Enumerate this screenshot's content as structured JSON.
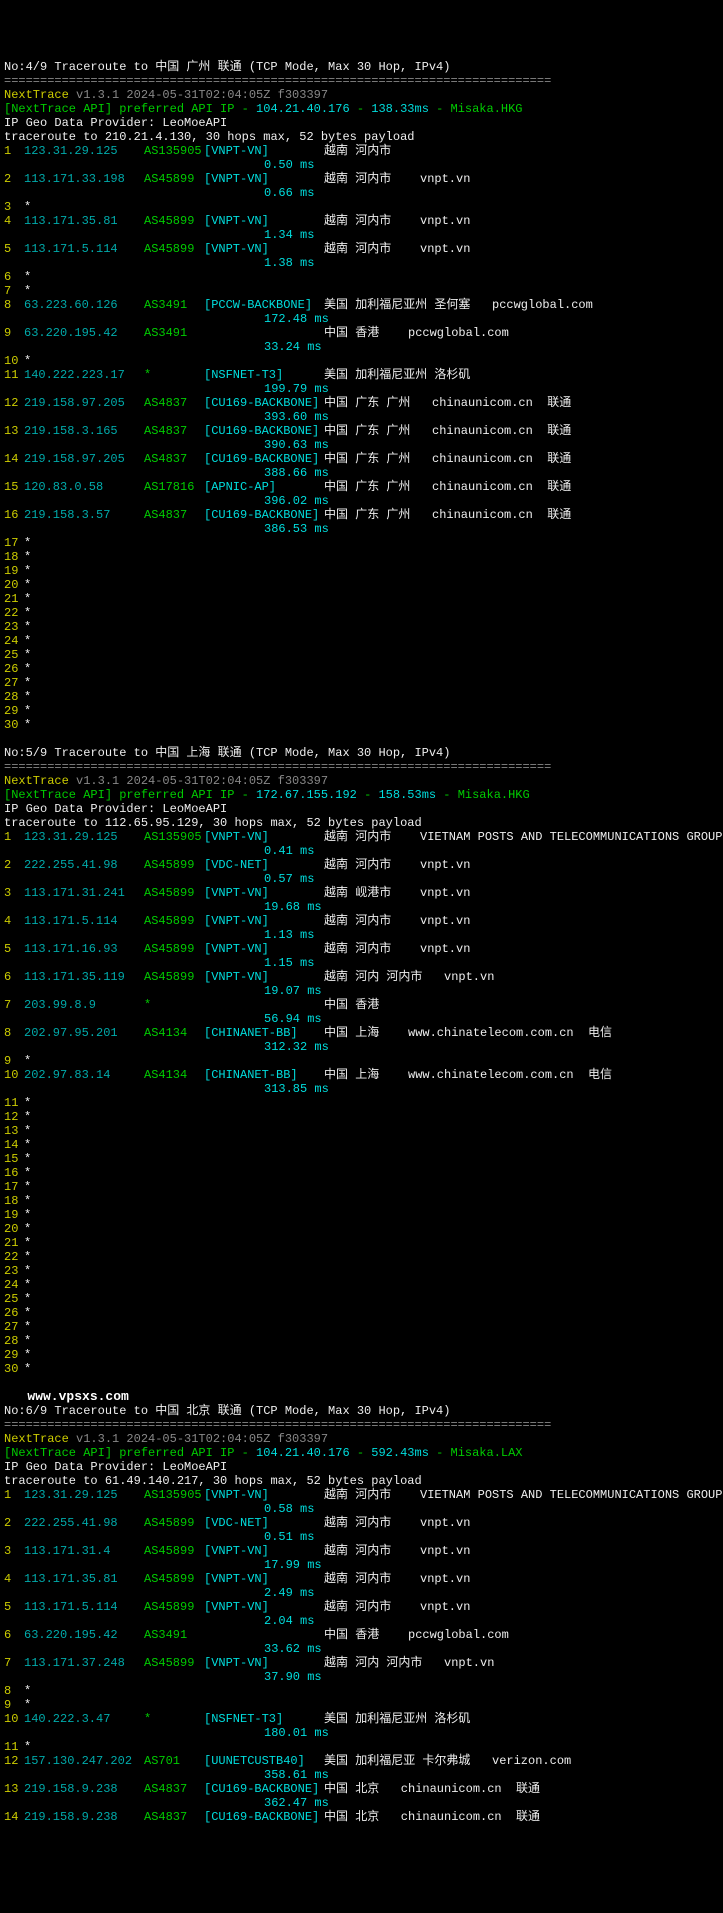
{
  "watermark": "www.vpsxs.com",
  "traces": [
    {
      "header": "No:4/9 Traceroute to 中国 广州 联通 (TCP Mode, Max 30 Hop, IPv4)",
      "version": "NextTrace v1.3.1 2024-05-31T02:04:05Z f303397",
      "api_prefix": "[NextTrace API] preferred API IP - ",
      "api_ip": "104.21.40.176",
      "api_sep": " - ",
      "api_ms": "138.33ms",
      "api_suffix": " - Misaka.HKG",
      "geo": "IP Geo Data Provider: LeoMoeAPI",
      "cmd": "traceroute to 210.21.4.130, 30 hops max, 52 bytes payload",
      "hops": [
        {
          "n": "1",
          "ip": "123.31.29.125",
          "as": "AS135905",
          "org": "[VNPT-VN]",
          "loc": "越南 河内市",
          "ms": "0.50 ms"
        },
        {
          "n": "2",
          "ip": "113.171.33.198",
          "as": "AS45899",
          "org": "[VNPT-VN]",
          "loc": "越南 河内市    vnpt.vn",
          "ms": "0.66 ms"
        },
        {
          "n": "3",
          "ip": "*"
        },
        {
          "n": "4",
          "ip": "113.171.35.81",
          "as": "AS45899",
          "org": "[VNPT-VN]",
          "loc": "越南 河内市    vnpt.vn",
          "ms": "1.34 ms"
        },
        {
          "n": "5",
          "ip": "113.171.5.114",
          "as": "AS45899",
          "org": "[VNPT-VN]",
          "loc": "越南 河内市    vnpt.vn",
          "ms": "1.38 ms"
        },
        {
          "n": "6",
          "ip": "*"
        },
        {
          "n": "7",
          "ip": "*"
        },
        {
          "n": "8",
          "ip": "63.223.60.126",
          "as": "AS3491",
          "org": "[PCCW-BACKBONE]",
          "loc": "美国 加利福尼亚州 圣何塞   pccwglobal.com",
          "ms": "172.48 ms"
        },
        {
          "n": "9",
          "ip": "63.220.195.42",
          "as": "AS3491",
          "org": "",
          "loc": "中国 香港    pccwglobal.com",
          "ms": "33.24 ms"
        },
        {
          "n": "10",
          "ip": "*"
        },
        {
          "n": "11",
          "ip": "140.222.223.17",
          "as": "*",
          "org": "[NSFNET-T3]",
          "loc": "美国 加利福尼亚州 洛杉矶",
          "ms": "199.79 ms"
        },
        {
          "n": "12",
          "ip": "219.158.97.205",
          "as": "AS4837",
          "org": "[CU169-BACKBONE]",
          "loc": "中国 广东 广州   chinaunicom.cn  联通",
          "ms": "393.60 ms"
        },
        {
          "n": "13",
          "ip": "219.158.3.165",
          "as": "AS4837",
          "org": "[CU169-BACKBONE]",
          "loc": "中国 广东 广州   chinaunicom.cn  联通",
          "ms": "390.63 ms"
        },
        {
          "n": "14",
          "ip": "219.158.97.205",
          "as": "AS4837",
          "org": "[CU169-BACKBONE]",
          "loc": "中国 广东 广州   chinaunicom.cn  联通",
          "ms": "388.66 ms"
        },
        {
          "n": "15",
          "ip": "120.83.0.58",
          "as": "AS17816",
          "org": "[APNIC-AP]",
          "loc": "中国 广东 广州   chinaunicom.cn  联通",
          "ms": "396.02 ms"
        },
        {
          "n": "16",
          "ip": "219.158.3.57",
          "as": "AS4837",
          "org": "[CU169-BACKBONE]",
          "loc": "中国 广东 广州   chinaunicom.cn  联通",
          "ms": "386.53 ms"
        },
        {
          "n": "17",
          "ip": "*"
        },
        {
          "n": "18",
          "ip": "*"
        },
        {
          "n": "19",
          "ip": "*"
        },
        {
          "n": "20",
          "ip": "*"
        },
        {
          "n": "21",
          "ip": "*"
        },
        {
          "n": "22",
          "ip": "*"
        },
        {
          "n": "23",
          "ip": "*"
        },
        {
          "n": "24",
          "ip": "*"
        },
        {
          "n": "25",
          "ip": "*"
        },
        {
          "n": "26",
          "ip": "*"
        },
        {
          "n": "27",
          "ip": "*"
        },
        {
          "n": "28",
          "ip": "*"
        },
        {
          "n": "29",
          "ip": "*"
        },
        {
          "n": "30",
          "ip": "*"
        }
      ]
    },
    {
      "header": "No:5/9 Traceroute to 中国 上海 联通 (TCP Mode, Max 30 Hop, IPv4)",
      "version": "NextTrace v1.3.1 2024-05-31T02:04:05Z f303397",
      "api_prefix": "[NextTrace API] preferred API IP - ",
      "api_ip": "172.67.155.192",
      "api_sep": " - ",
      "api_ms": "158.53ms",
      "api_suffix": " - Misaka.HKG",
      "geo": "IP Geo Data Provider: LeoMoeAPI",
      "cmd": "traceroute to 112.65.95.129, 30 hops max, 52 bytes payload",
      "hops": [
        {
          "n": "1",
          "ip": "123.31.29.125",
          "as": "AS135905",
          "org": "[VNPT-VN]",
          "loc": "越南 河内市    VIETNAM POSTS AND TELECOMMUNICATIONS GROUP",
          "ms": "0.41 ms"
        },
        {
          "n": "2",
          "ip": "222.255.41.98",
          "as": "AS45899",
          "org": "[VDC-NET]",
          "loc": "越南 河内市    vnpt.vn",
          "ms": "0.57 ms"
        },
        {
          "n": "3",
          "ip": "113.171.31.241",
          "as": "AS45899",
          "org": "[VNPT-VN]",
          "loc": "越南 岘港市    vnpt.vn",
          "ms": "19.68 ms"
        },
        {
          "n": "4",
          "ip": "113.171.5.114",
          "as": "AS45899",
          "org": "[VNPT-VN]",
          "loc": "越南 河内市    vnpt.vn",
          "ms": "1.13 ms"
        },
        {
          "n": "5",
          "ip": "113.171.16.93",
          "as": "AS45899",
          "org": "[VNPT-VN]",
          "loc": "越南 河内市    vnpt.vn",
          "ms": "1.15 ms"
        },
        {
          "n": "6",
          "ip": "113.171.35.119",
          "as": "AS45899",
          "org": "[VNPT-VN]",
          "loc": "越南 河内 河内市   vnpt.vn",
          "ms": "19.07 ms"
        },
        {
          "n": "7",
          "ip": "203.99.8.9",
          "as": "*",
          "org": "",
          "loc": "中国 香港",
          "ms": "56.94 ms"
        },
        {
          "n": "8",
          "ip": "202.97.95.201",
          "as": "AS4134",
          "org": "[CHINANET-BB]",
          "loc": "中国 上海    www.chinatelecom.com.cn  电信",
          "ms": "312.32 ms"
        },
        {
          "n": "9",
          "ip": "*"
        },
        {
          "n": "10",
          "ip": "202.97.83.14",
          "as": "AS4134",
          "org": "[CHINANET-BB]",
          "loc": "中国 上海    www.chinatelecom.com.cn  电信",
          "ms": "313.85 ms"
        },
        {
          "n": "11",
          "ip": "*"
        },
        {
          "n": "12",
          "ip": "*"
        },
        {
          "n": "13",
          "ip": "*"
        },
        {
          "n": "14",
          "ip": "*"
        },
        {
          "n": "15",
          "ip": "*"
        },
        {
          "n": "16",
          "ip": "*"
        },
        {
          "n": "17",
          "ip": "*"
        },
        {
          "n": "18",
          "ip": "*"
        },
        {
          "n": "19",
          "ip": "*"
        },
        {
          "n": "20",
          "ip": "*"
        },
        {
          "n": "21",
          "ip": "*"
        },
        {
          "n": "22",
          "ip": "*"
        },
        {
          "n": "23",
          "ip": "*"
        },
        {
          "n": "24",
          "ip": "*"
        },
        {
          "n": "25",
          "ip": "*"
        },
        {
          "n": "26",
          "ip": "*"
        },
        {
          "n": "27",
          "ip": "*"
        },
        {
          "n": "28",
          "ip": "*"
        },
        {
          "n": "29",
          "ip": "*"
        },
        {
          "n": "30",
          "ip": "*"
        }
      ]
    },
    {
      "header": "No:6/9 Traceroute to 中国 北京 联通 (TCP Mode, Max 30 Hop, IPv4)",
      "version": "NextTrace v1.3.1 2024-05-31T02:04:05Z f303397",
      "api_prefix": "[NextTrace API] preferred API IP - ",
      "api_ip": "104.21.40.176",
      "api_sep": " - ",
      "api_ms": "592.43ms",
      "api_suffix": " - Misaka.LAX",
      "geo": "IP Geo Data Provider: LeoMoeAPI",
      "cmd": "traceroute to 61.49.140.217, 30 hops max, 52 bytes payload",
      "hops": [
        {
          "n": "1",
          "ip": "123.31.29.125",
          "as": "AS135905",
          "org": "[VNPT-VN]",
          "loc": "越南 河内市    VIETNAM POSTS AND TELECOMMUNICATIONS GROUP",
          "ms": "0.58 ms"
        },
        {
          "n": "2",
          "ip": "222.255.41.98",
          "as": "AS45899",
          "org": "[VDC-NET]",
          "loc": "越南 河内市    vnpt.vn",
          "ms": "0.51 ms"
        },
        {
          "n": "3",
          "ip": "113.171.31.4",
          "as": "AS45899",
          "org": "[VNPT-VN]",
          "loc": "越南 河内市    vnpt.vn",
          "ms": "17.99 ms"
        },
        {
          "n": "4",
          "ip": "113.171.35.81",
          "as": "AS45899",
          "org": "[VNPT-VN]",
          "loc": "越南 河内市    vnpt.vn",
          "ms": "2.49 ms"
        },
        {
          "n": "5",
          "ip": "113.171.5.114",
          "as": "AS45899",
          "org": "[VNPT-VN]",
          "loc": "越南 河内市    vnpt.vn",
          "ms": "2.04 ms"
        },
        {
          "n": "6",
          "ip": "63.220.195.42",
          "as": "AS3491",
          "org": "",
          "loc": "中国 香港    pccwglobal.com",
          "ms": "33.62 ms"
        },
        {
          "n": "7",
          "ip": "113.171.37.248",
          "as": "AS45899",
          "org": "[VNPT-VN]",
          "loc": "越南 河内 河内市   vnpt.vn",
          "ms": "37.90 ms"
        },
        {
          "n": "8",
          "ip": "*"
        },
        {
          "n": "9",
          "ip": "*"
        },
        {
          "n": "10",
          "ip": "140.222.3.47",
          "as": "*",
          "org": "[NSFNET-T3]",
          "loc": "美国 加利福尼亚州 洛杉矶",
          "ms": "180.01 ms"
        },
        {
          "n": "11",
          "ip": "*"
        },
        {
          "n": "12",
          "ip": "157.130.247.202",
          "as": "AS701",
          "org": "[UUNETCUSTB40]",
          "loc": "美国 加利福尼亚 卡尔弗城   verizon.com",
          "ms": "358.61 ms"
        },
        {
          "n": "13",
          "ip": "219.158.9.238",
          "as": "AS4837",
          "org": "[CU169-BACKBONE]",
          "loc": "中国 北京   chinaunicom.cn  联通",
          "ms": "362.47 ms"
        },
        {
          "n": "14",
          "ip": "219.158.9.238",
          "as": "AS4837",
          "org": "[CU169-BACKBONE]",
          "loc": "中国 北京   chinaunicom.cn  联通",
          "ms": ""
        }
      ]
    }
  ]
}
